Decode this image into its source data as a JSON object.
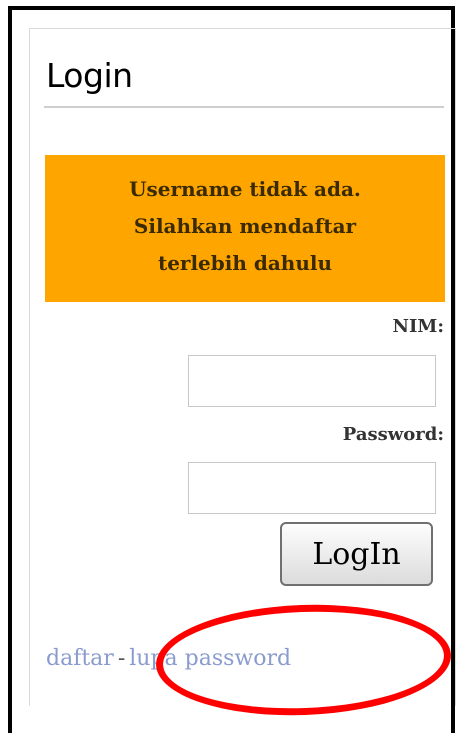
{
  "login": {
    "title": "Login",
    "alert_lines": [
      "Username tidak ada.",
      "Silahkan mendaftar",
      "terlebih dahulu"
    ],
    "nim_label": "NIM:",
    "nim_value": "",
    "password_label": "Password:",
    "password_value": "",
    "submit_label": "LogIn",
    "register_link": "daftar",
    "separator": "-",
    "forgot_link": "lupa password"
  },
  "colors": {
    "alert_background": "#ffa500",
    "highlight": "#ff0000",
    "link": "#8a9bcf"
  }
}
